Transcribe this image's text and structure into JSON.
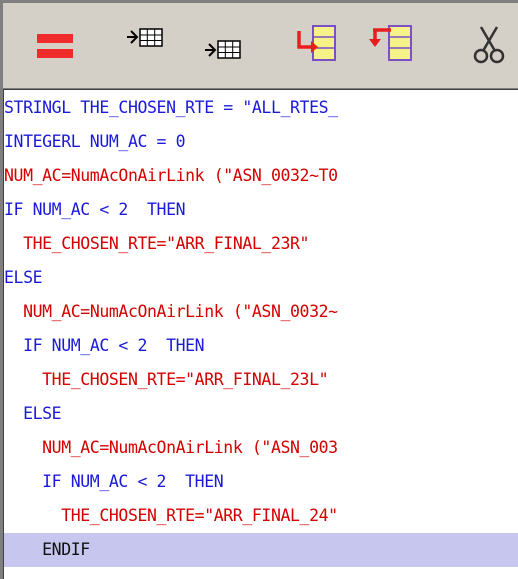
{
  "toolbar": {
    "buttons": [
      {
        "name": "equals-icon"
      },
      {
        "name": "insert-table-above-icon"
      },
      {
        "name": "insert-table-below-icon"
      },
      {
        "name": "move-block-right-icon"
      },
      {
        "name": "move-block-left-icon"
      },
      {
        "name": "scissors-icon"
      }
    ]
  },
  "colors": {
    "keyword": "#1a1ad8",
    "statement": "#d40000",
    "current_line": "#c6c6ef",
    "toolbar_bg": "#d4d0c8"
  },
  "code": {
    "lines": [
      {
        "text": "STRINGL THE_CHOSEN_RTE = \"ALL_RTES_",
        "indent": "",
        "kind": "kw"
      },
      {
        "text": "INTEGERL NUM_AC = 0",
        "indent": "",
        "kind": "kw"
      },
      {
        "text": "NUM_AC=NumAcOnAirLink (\"ASN_0032~T0",
        "indent": "",
        "kind": "tx"
      },
      {
        "text": "IF NUM_AC < 2  THEN",
        "indent": "",
        "kind": "kw"
      },
      {
        "text": "THE_CHOSEN_RTE=\"ARR_FINAL_23R\"",
        "indent": "  ",
        "kind": "tx"
      },
      {
        "text": "ELSE",
        "indent": "",
        "kind": "kw"
      },
      {
        "text": "NUM_AC=NumAcOnAirLink (\"ASN_0032~",
        "indent": "  ",
        "kind": "tx"
      },
      {
        "text": "IF NUM_AC < 2  THEN",
        "indent": "  ",
        "kind": "kw"
      },
      {
        "text": "THE_CHOSEN_RTE=\"ARR_FINAL_23L\"",
        "indent": "    ",
        "kind": "tx"
      },
      {
        "text": "ELSE",
        "indent": "  ",
        "kind": "kw"
      },
      {
        "text": "NUM_AC=NumAcOnAirLink (\"ASN_003",
        "indent": "    ",
        "kind": "tx"
      },
      {
        "text": "IF NUM_AC < 2  THEN",
        "indent": "    ",
        "kind": "kw"
      },
      {
        "text": "THE_CHOSEN_RTE=\"ARR_FINAL_24\"",
        "indent": "      ",
        "kind": "tx"
      },
      {
        "text": "ENDIF",
        "indent": "    ",
        "kind": "kwd",
        "current": true
      }
    ]
  }
}
